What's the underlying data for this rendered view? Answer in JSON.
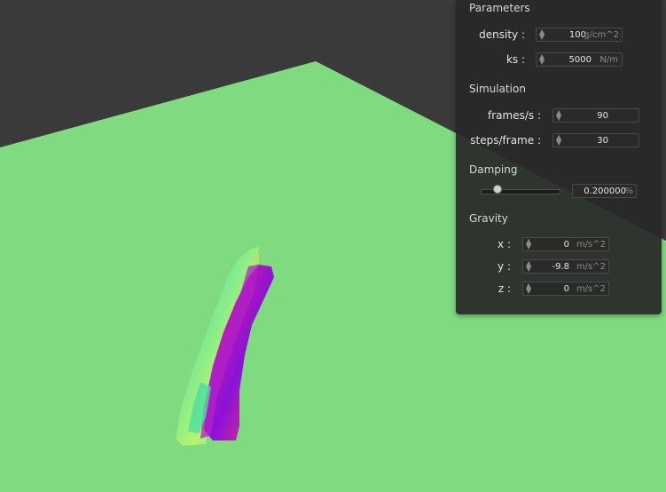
{
  "panel": {
    "parameters": {
      "title": "Parameters",
      "density": {
        "label": "density :",
        "value": "100",
        "unit": "g/cm^2"
      },
      "ks": {
        "label": "ks :",
        "value": "5000",
        "unit": "N/m"
      }
    },
    "simulation": {
      "title": "Simulation",
      "frames": {
        "label": "frames/s :",
        "value": "90"
      },
      "steps": {
        "label": "steps/frame :",
        "value": "30"
      }
    },
    "damping": {
      "title": "Damping",
      "level": 0.2,
      "value": "0.200000",
      "unit": "%"
    },
    "gravity": {
      "title": "Gravity",
      "x": {
        "label": "x :",
        "value": "0",
        "unit": "m/s^2"
      },
      "y": {
        "label": "y :",
        "value": "-9.8",
        "unit": "m/s^2"
      },
      "z": {
        "label": "z :",
        "value": "0",
        "unit": "m/s^2"
      }
    }
  },
  "colors": {
    "ground": "#80da80",
    "background": "#3a3a3a",
    "cloth_green": "#86f06a",
    "cloth_purple": "#9a1ad0"
  }
}
